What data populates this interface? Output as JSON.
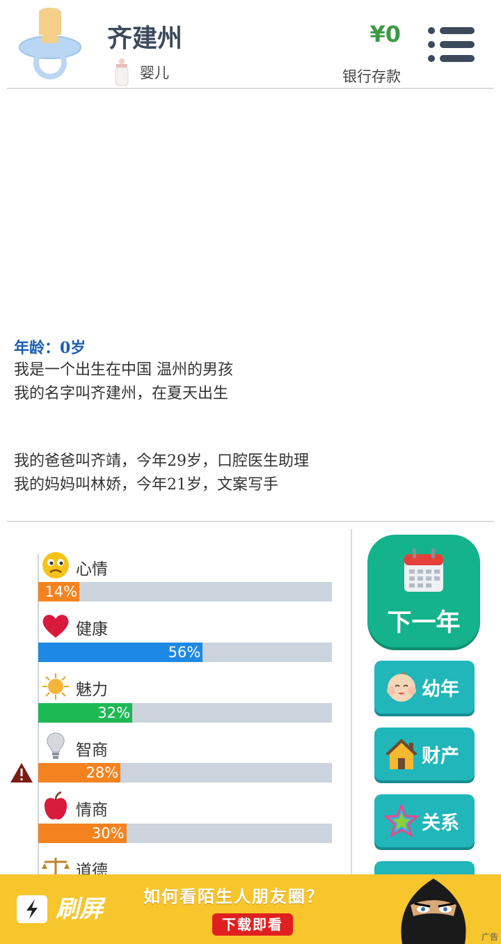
{
  "profile": {
    "name": "齐建州",
    "stage": "婴儿",
    "money": "¥0",
    "money_label": "银行存款"
  },
  "story": {
    "age_line": "年龄：0岁",
    "lines": [
      "我是一个出生在中国 温州的男孩",
      "我的名字叫齐建州，在夏天出生",
      "我的爸爸叫齐靖，今年29岁，口腔医生助理",
      "我的妈妈叫林娇，今年21岁，文案写手"
    ]
  },
  "stats": [
    {
      "label": "心情",
      "percent": 14,
      "text": "14%",
      "color": "#f4831f",
      "icon": "sad-face-icon"
    },
    {
      "label": "健康",
      "percent": 56,
      "text": "56%",
      "color": "#1e88e5",
      "icon": "heart-icon"
    },
    {
      "label": "魅力",
      "percent": 32,
      "text": "32%",
      "color": "#1db954",
      "icon": "sun-icon"
    },
    {
      "label": "智商",
      "percent": 28,
      "text": "28%",
      "color": "#f4831f",
      "icon": "lightbulb-icon",
      "warning": true
    },
    {
      "label": "情商",
      "percent": 30,
      "text": "30%",
      "color": "#f4831f",
      "icon": "apple-icon"
    },
    {
      "label": "道德",
      "icon": "scales-icon"
    }
  ],
  "actions": {
    "next_year": "下一年",
    "childhood": "幼年",
    "assets": "财产",
    "relations": "关系"
  },
  "ad": {
    "brand": "刷屏",
    "headline": "如何看陌生人朋友圈？",
    "cta": "下载即看",
    "tag": "广告"
  }
}
